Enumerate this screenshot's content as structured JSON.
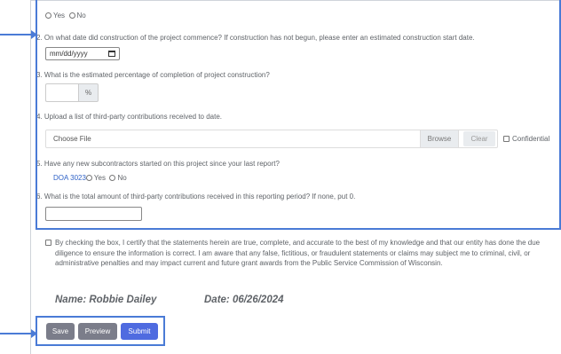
{
  "form": {
    "q1_options": {
      "yes": "Yes",
      "no": "No"
    },
    "q2": {
      "label": "2. On what date did construction of the project commence? If construction has not begun, please enter an estimated construction start date.",
      "placeholder": "mm/dd/yyyy"
    },
    "q3": {
      "label": "3. What is the estimated percentage of completion of project construction?",
      "addon": "%"
    },
    "q4": {
      "label": "4. Upload a list of third-party contributions received to date.",
      "choose_file": "Choose File",
      "browse": "Browse",
      "clear": "Clear",
      "confidential": "Confidential"
    },
    "q5": {
      "label": "5. Have any new subcontractors started on this project since your last report?",
      "link": "DOA 3023",
      "yes": "Yes",
      "no": "No"
    },
    "q6": {
      "label": "6. What is the total amount of third-party contributions received in this reporting period? If none, put 0."
    },
    "certification": "By checking the box, I certify that the statements herein are true, complete, and accurate to the best of my knowledge and that our entity has done the due diligence to ensure the information is correct. I am aware that any false, fictitious, or fraudulent statements or claims may subject me to criminal, civil, or administrative penalties and may impact current and future grant awards from the Public Service Commission of Wisconsin.",
    "name_line": "Name: Robbie Dailey",
    "date_line": "Date: 06/26/2024",
    "buttons": {
      "save": "Save",
      "preview": "Preview",
      "submit": "Submit"
    }
  },
  "colors": {
    "highlight": "#4a7bd6",
    "submit": "#4f6be0",
    "secondary": "#7b7d8a",
    "link": "#2f62c7"
  }
}
